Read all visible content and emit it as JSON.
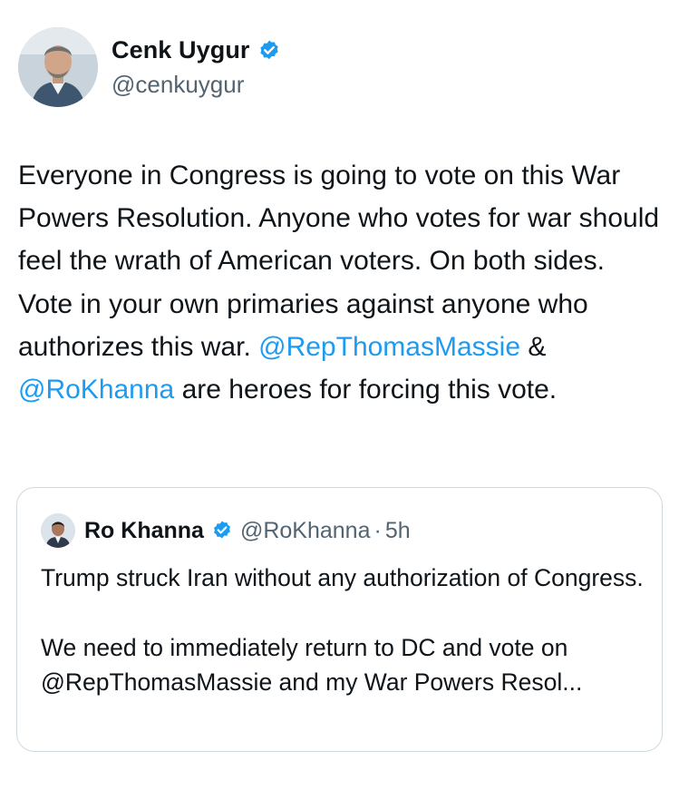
{
  "author": {
    "name": "Cenk Uygur",
    "handle": "@cenkuygur",
    "verified": true
  },
  "tweet": {
    "segments": [
      {
        "type": "text",
        "value": "Everyone in Congress is going to vote on this War Powers Resolution. Anyone who votes for war should feel the wrath of American voters. On both sides. Vote in your own primaries against anyone who authorizes this war. "
      },
      {
        "type": "mention",
        "value": "@RepThomasMassie"
      },
      {
        "type": "text",
        "value": " & "
      },
      {
        "type": "mention",
        "value": "@RoKhanna"
      },
      {
        "type": "text",
        "value": " are heroes for forcing this vote."
      }
    ]
  },
  "quote": {
    "author_name": "Ro Khanna",
    "handle": "@RoKhanna",
    "separator": "·",
    "time": "5h",
    "verified": true,
    "paragraphs": [
      "Trump struck Iran without any authorization of Congress.",
      "We need to immediately return to DC and vote on @RepThomasMassie and my War Powers Resol..."
    ]
  },
  "colors": {
    "text": "#0f1419",
    "secondary": "#536471",
    "accent": "#1d9bf0",
    "border": "#cfd9de"
  },
  "icons": [
    "avatar-photo",
    "verified-badge-icon"
  ]
}
